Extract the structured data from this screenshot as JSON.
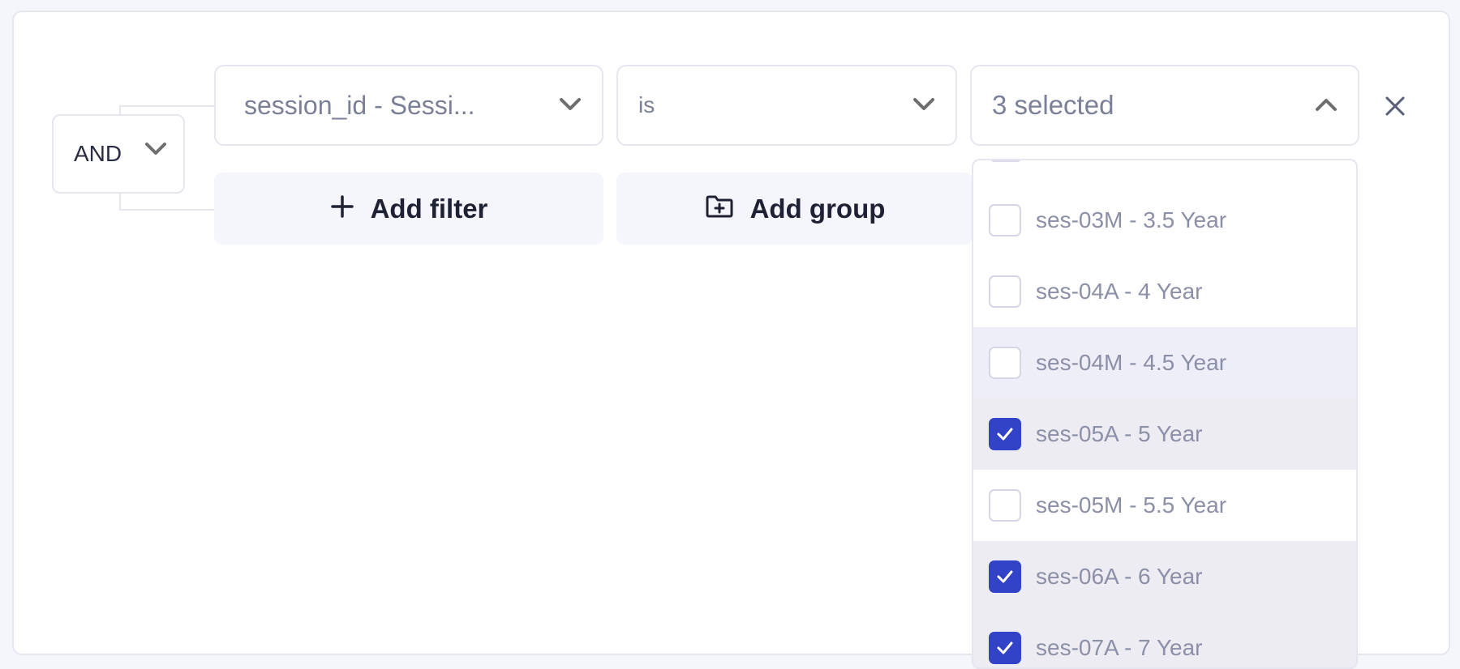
{
  "colors": {
    "accent": "#3343c7",
    "border": "#e6e6f0",
    "text_muted": "#7b7f98",
    "button_bg": "#f5f6fb"
  },
  "group": {
    "operator": "AND"
  },
  "filter": {
    "field_value": "session_id - Sessi...",
    "condition_value": "is",
    "values_summary": "3 selected"
  },
  "actions": {
    "add_filter_label": "Add filter",
    "add_group_label": "Add group"
  },
  "dropdown": {
    "options": [
      {
        "label": "ses-03M - 3.5 Year",
        "checked": false
      },
      {
        "label": "ses-04A - 4 Year",
        "checked": false
      },
      {
        "label": "ses-04M - 4.5 Year",
        "checked": false,
        "hovered": true
      },
      {
        "label": "ses-05A - 5 Year",
        "checked": true
      },
      {
        "label": "ses-05M - 5.5 Year",
        "checked": false
      },
      {
        "label": "ses-06A - 6 Year",
        "checked": true
      },
      {
        "label": "ses-07A - 7 Year",
        "checked": true
      }
    ]
  }
}
